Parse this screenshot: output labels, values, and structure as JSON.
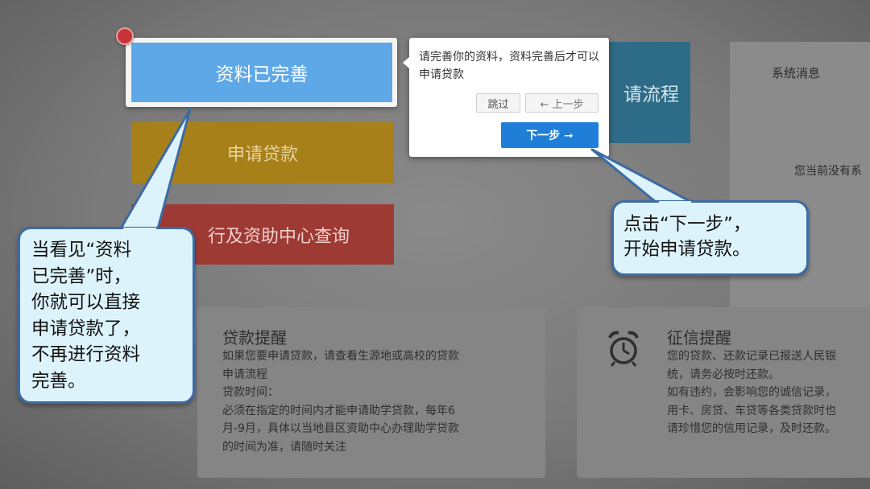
{
  "tiles": {
    "apply_loan": "申请贷款",
    "bank_query": "行及资助中心查询",
    "apply_process": "请流程"
  },
  "right_panel": {
    "title": "系统消息",
    "no_message": "您当前没有系"
  },
  "loan_card": {
    "title": "贷款提醒",
    "body": "如果您要申请贷款，请查看生源地或高校的贷款\n申请流程\n贷款时间：\n必须在指定的时间内才能申请助学贷款，每年6\n月-9月，具体以当地县区资助中心办理助学贷款\n的时间为准，请随时关注"
  },
  "credit_card": {
    "title": "征信提醒",
    "icon": "alarm-clock-icon",
    "body": "您的贷款、还款记录已报送人民银\n统，请务必按时还款。\n如有违约，会影响您的诚信记录，\n用卡、房贷、车贷等各类贷款时也\n请珍惜您的信用记录，及时还款。"
  },
  "highlight": {
    "label": "资料已完善"
  },
  "tooltip": {
    "text": "请完善你的资料，资料完善后才可以申请贷款",
    "skip": "跳过",
    "prev": "← 上一步",
    "next": "下一步 ➞"
  },
  "callouts": {
    "left": "当看见“资料\n已完善”时，\n你就可以直接\n申请贷款了，\n不再进行资料\n完善。",
    "right": "点击“下一步”，\n开始申请贷款。"
  },
  "colors": {
    "highlight_blue": "#5fa8e8",
    "next_button": "#1f7fd8",
    "callout_fill": "#ddf3fb",
    "callout_border": "#3d6aa3"
  }
}
